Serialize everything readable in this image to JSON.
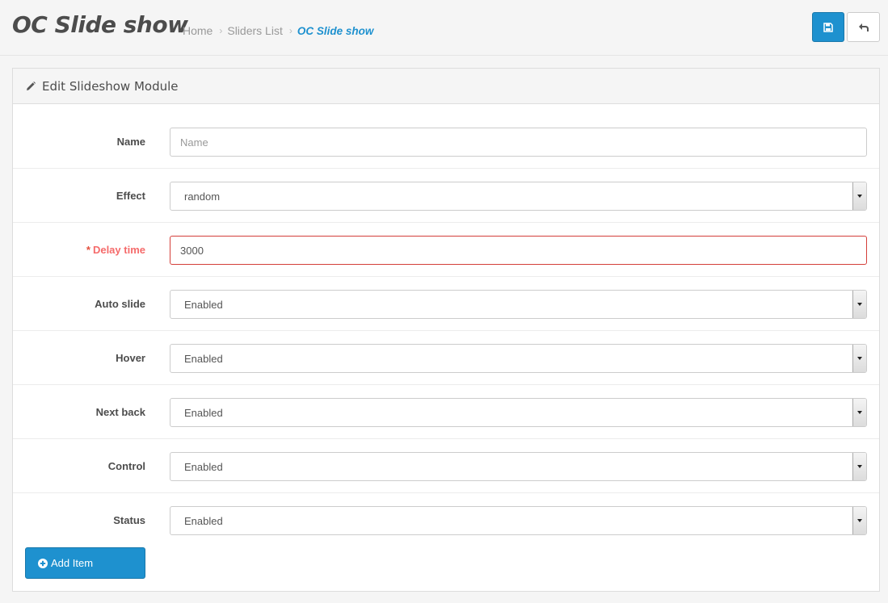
{
  "header": {
    "title": "OC Slide show",
    "breadcrumb": [
      "Home",
      "Sliders List",
      "OC Slide show"
    ],
    "save_icon": "save-icon",
    "back_icon": "reply-icon"
  },
  "panel": {
    "title": "Edit Slideshow Module",
    "icon": "pencil-icon"
  },
  "form": {
    "name": {
      "label": "Name",
      "placeholder": "Name",
      "value": ""
    },
    "effect": {
      "label": "Effect",
      "value": "random"
    },
    "delay": {
      "label": "Delay time",
      "value": "3000"
    },
    "auto_slide": {
      "label": "Auto slide",
      "value": "Enabled"
    },
    "hover": {
      "label": "Hover",
      "value": "Enabled"
    },
    "next_back": {
      "label": "Next back",
      "value": "Enabled"
    },
    "control": {
      "label": "Control",
      "value": "Enabled"
    },
    "status": {
      "label": "Status",
      "value": "Enabled"
    }
  },
  "actions": {
    "add_item": "Add Item",
    "add_icon": "plus-circle-icon"
  },
  "colors": {
    "primary": "#1e91cf",
    "error": "#d43f3a",
    "required_label": "#f56b6b"
  }
}
